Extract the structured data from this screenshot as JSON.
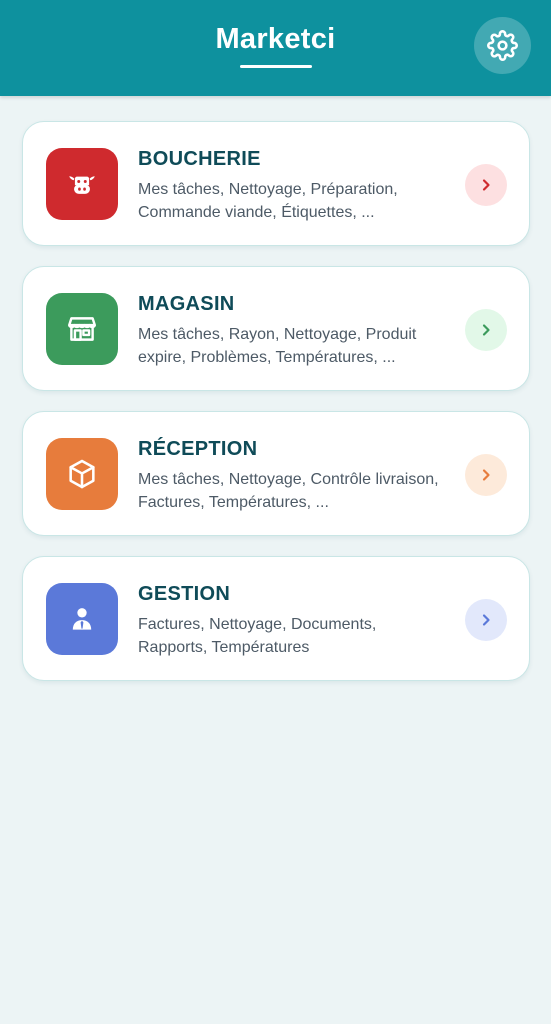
{
  "app": {
    "title": "Marketci",
    "header_color": "#0e919e",
    "background_color": "#ecf4f5",
    "settings_icon": "gear-icon"
  },
  "sections": [
    {
      "title": "BOUCHERIE",
      "subtitle": "Mes tâches, Nettoyage, Préparation, Commande viande, Étiquettes, ...",
      "icon": "cow-icon",
      "color": "#cf2a2e",
      "arrow_bg": "#fde0e1",
      "arrow_color": "#cf2a2e"
    },
    {
      "title": "MAGASIN",
      "subtitle": "Mes tâches, Rayon, Nettoyage, Produit expire, Problèmes, Températures, ...",
      "icon": "storefront-icon",
      "color": "#3c9b5c",
      "arrow_bg": "#e2f8e8",
      "arrow_color": "#3c9b5c"
    },
    {
      "title": "RÉCEPTION",
      "subtitle": "Mes tâches, Nettoyage, Contrôle livraison, Factures, Températures, ...",
      "icon": "package-box-icon",
      "color": "#e77c3c",
      "arrow_bg": "#fdeada",
      "arrow_color": "#e77c3c"
    },
    {
      "title": "GESTION",
      "subtitle": "Factures, Nettoyage, Documents, Rapports, Températures",
      "icon": "manager-user-icon",
      "color": "#5b79d9",
      "arrow_bg": "#e2e8fb",
      "arrow_color": "#5b79d9"
    }
  ]
}
